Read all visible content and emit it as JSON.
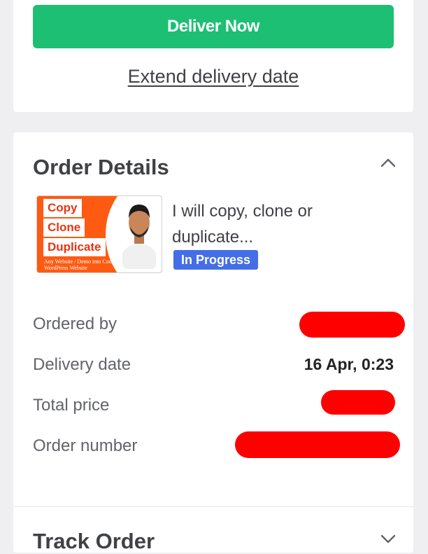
{
  "actions": {
    "deliver_label": "Deliver Now",
    "extend_label": "Extend delivery date"
  },
  "order_details": {
    "title": "Order Details",
    "gig": {
      "title": "I will copy, clone or duplicate...",
      "status": "In Progress",
      "thumbnail_text": {
        "line1": "Copy",
        "line2": "Clone",
        "line3": "Duplicate",
        "caption": "Any Website / Demo into Convert WordPress Website"
      }
    },
    "rows": [
      {
        "label": "Ordered by",
        "value": ""
      },
      {
        "label": "Delivery date",
        "value": "16 Apr, 0:23"
      },
      {
        "label": "Total price",
        "value": ""
      },
      {
        "label": "Order number",
        "value": ""
      }
    ]
  },
  "track_order": {
    "title": "Track Order"
  },
  "colors": {
    "primary_green": "#1dbf73",
    "status_blue": "#446ee7",
    "redaction": "#ff0000"
  }
}
